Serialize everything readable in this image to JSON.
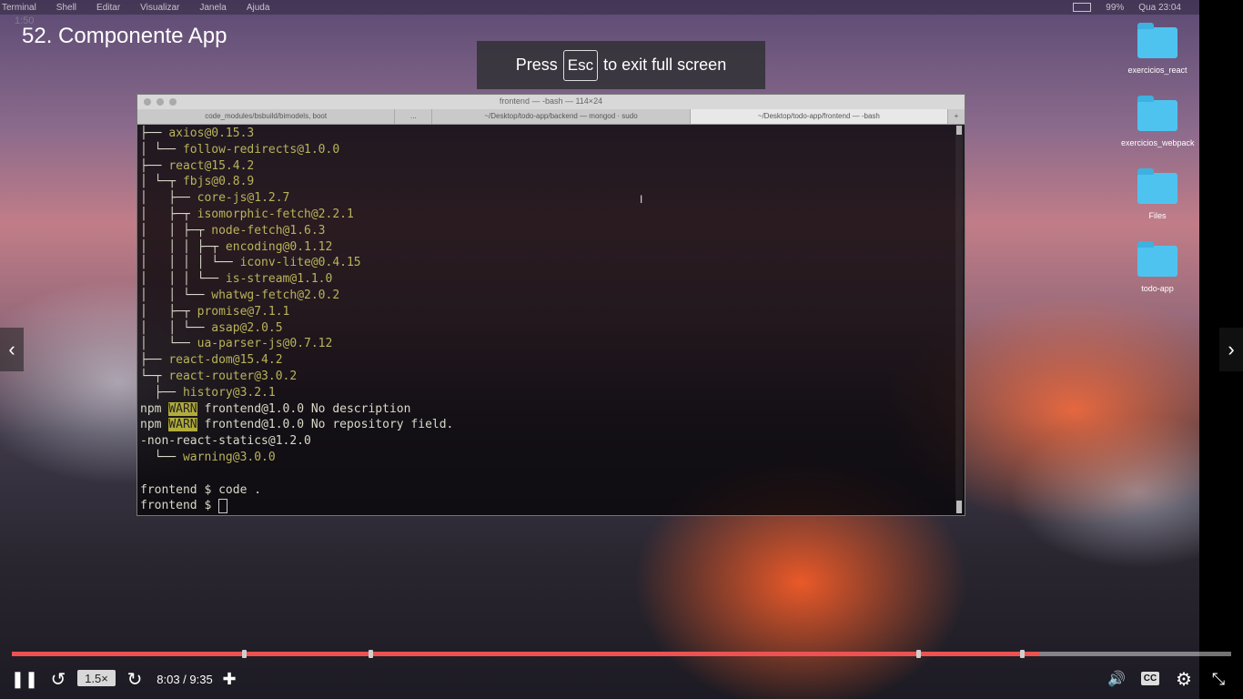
{
  "mac_menubar": {
    "items": [
      "Terminal",
      "Shell",
      "Editar",
      "Visualizar",
      "Janela",
      "Ajuda"
    ],
    "battery": "99%",
    "clock": "Qua 23:04"
  },
  "video": {
    "ghost_time": "1:50",
    "lecture_title": "52. Componente App",
    "fullscreen_hint": {
      "before": "Press",
      "key": "Esc",
      "after": "to exit full screen"
    }
  },
  "desktop_icons": [
    {
      "label": "exercicios_react"
    },
    {
      "label": "exercicios_webpack"
    },
    {
      "label": "Files"
    },
    {
      "label": "todo-app"
    }
  ],
  "terminal": {
    "title": "frontend — -bash — 114×24",
    "tabs": [
      {
        "label": "code_modules/bsbuild/bimodels, boot"
      },
      {
        "label": "..."
      },
      {
        "label": "~/Desktop/todo-app/backend — mongod · sudo"
      },
      {
        "label": "~/Desktop/todo-app/frontend — -bash"
      },
      {
        "label": "+"
      }
    ],
    "lines": [
      {
        "tree": "├── ",
        "pkg": "axios@0.15.3"
      },
      {
        "tree": "│ └── ",
        "pkg": "follow-redirects@1.0.0"
      },
      {
        "tree": "├── ",
        "pkg": "react@15.4.2"
      },
      {
        "tree": "│ └─┬ ",
        "pkg": "fbjs@0.8.9"
      },
      {
        "tree": "│   ├── ",
        "pkg": "core-js@1.2.7"
      },
      {
        "tree": "│   ├─┬ ",
        "pkg": "isomorphic-fetch@2.2.1"
      },
      {
        "tree": "│   │ ├─┬ ",
        "pkg": "node-fetch@1.6.3"
      },
      {
        "tree": "│   │ │ ├─┬ ",
        "pkg": "encoding@0.1.12"
      },
      {
        "tree": "│   │ │ │ └── ",
        "pkg": "iconv-lite@0.4.15"
      },
      {
        "tree": "│   │ │ └── ",
        "pkg": "is-stream@1.1.0"
      },
      {
        "tree": "│   │ └── ",
        "pkg": "whatwg-fetch@2.0.2"
      },
      {
        "tree": "│   ├─┬ ",
        "pkg": "promise@7.1.1"
      },
      {
        "tree": "│   │ └── ",
        "pkg": "asap@2.0.5"
      },
      {
        "tree": "│   └── ",
        "pkg": "ua-parser-js@0.7.12"
      },
      {
        "tree": "├── ",
        "pkg": "react-dom@15.4.2"
      },
      {
        "tree": "└─┬ ",
        "pkg": "react-router@3.0.2"
      },
      {
        "tree": "  ├── ",
        "pkg": "history@3.2.1"
      }
    ],
    "warn_lines": [
      {
        "prefix": "npm ",
        "badge": "WARN",
        "text": " frontend@1.0.0 No description"
      },
      {
        "prefix": "npm ",
        "badge": "WARN",
        "text": " frontend@1.0.0 No repository field."
      }
    ],
    "tail_lines": [
      {
        "tree": "-non-react-statics@1.2.0",
        "pkg": ""
      },
      {
        "tree": "  └── ",
        "pkg": "warning@3.0.0"
      }
    ],
    "prompt_lines": [
      "frontend $ code .",
      "frontend $ "
    ]
  },
  "player": {
    "progress": 0.843,
    "markers": [
      0.19,
      0.294,
      0.743,
      0.828
    ],
    "speed": "1.5×",
    "time": "8:03 / 9:35",
    "colors": {
      "progress": "#ec5252",
      "track": "#9a9a9a"
    }
  }
}
